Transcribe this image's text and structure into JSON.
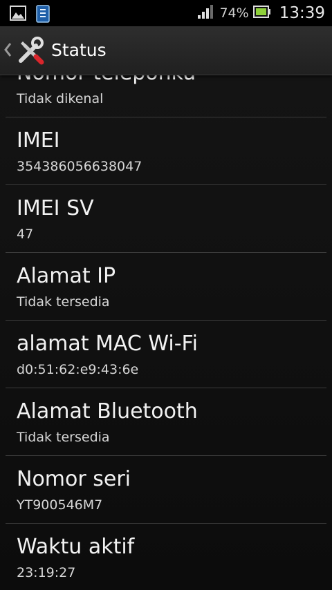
{
  "status_bar": {
    "battery_percent": "74%",
    "time": "13:39",
    "signal_level": 0.8,
    "battery_level": 0.74
  },
  "action_bar": {
    "title": "Status"
  },
  "items": [
    {
      "title": "Nomor teleponku",
      "value": "Tidak dikenal"
    },
    {
      "title": "IMEI",
      "value": "354386056638047"
    },
    {
      "title": "IMEI SV",
      "value": "47"
    },
    {
      "title": "Alamat IP",
      "value": "Tidak tersedia"
    },
    {
      "title": "alamat MAC Wi-Fi",
      "value": "d0:51:62:e9:43:6e"
    },
    {
      "title": "Alamat Bluetooth",
      "value": "Tidak tersedia"
    },
    {
      "title": "Nomor seri",
      "value": "YT900546M7"
    },
    {
      "title": "Waktu aktif",
      "value": "23:19:27"
    }
  ]
}
